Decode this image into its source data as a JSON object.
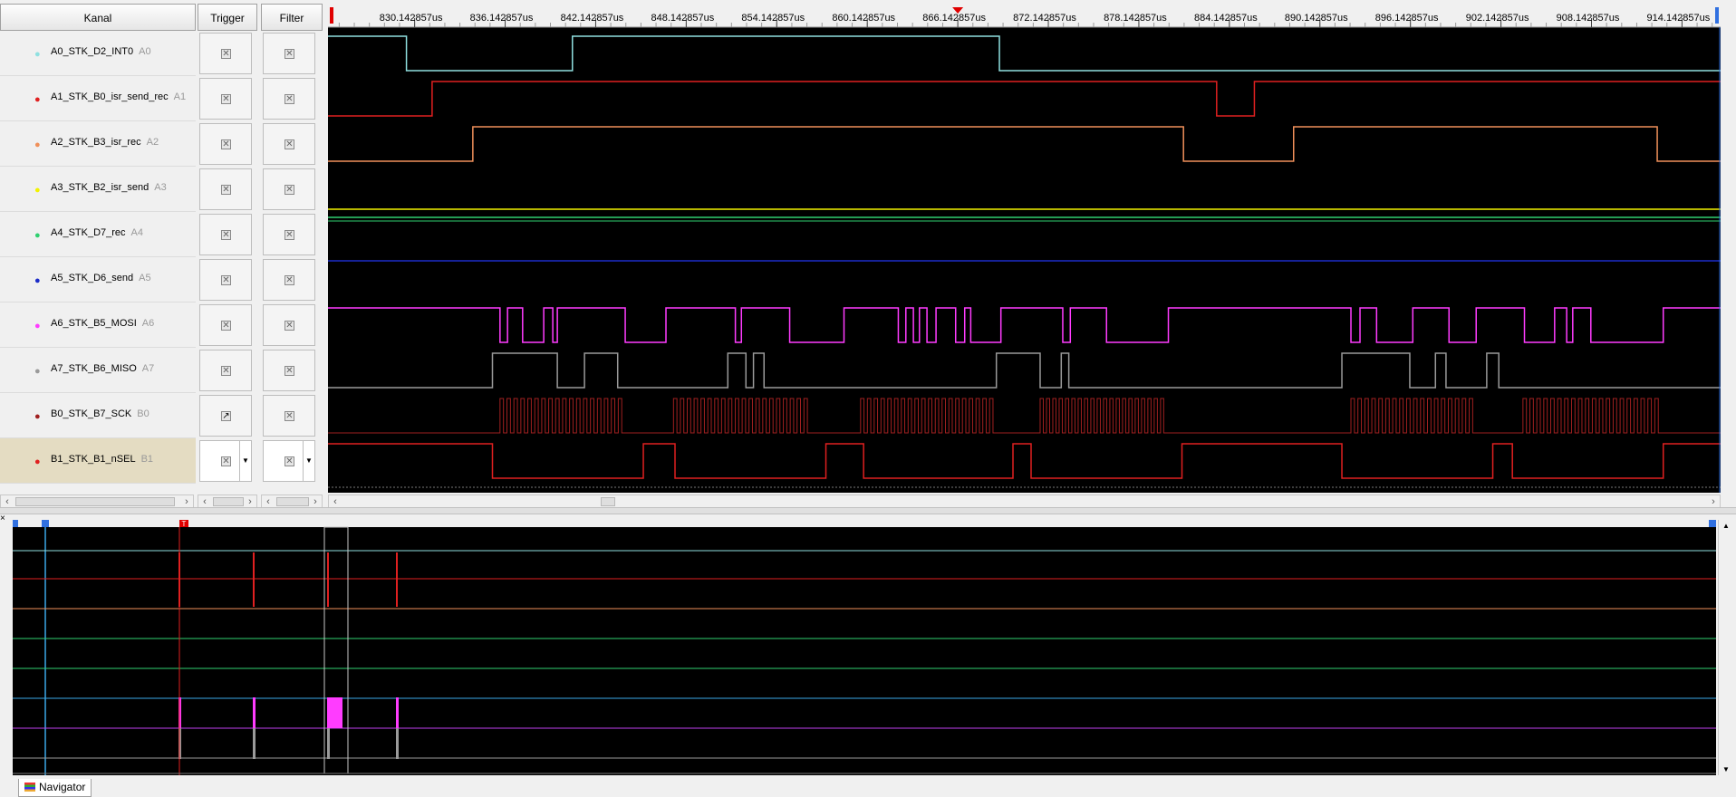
{
  "headers": {
    "channel": "Kanal",
    "trigger": "Trigger",
    "filter": "Filter"
  },
  "channels": [
    {
      "label": "A0_STK_D2_INT0",
      "pin": "A0",
      "color": "#8fe0e0"
    },
    {
      "label": "A1_STK_B0_isr_send_rec",
      "pin": "A1",
      "color": "#e02020"
    },
    {
      "label": "A2_STK_B3_isr_rec",
      "pin": "A2",
      "color": "#f0905a"
    },
    {
      "label": "A3_STK_B2_isr_send",
      "pin": "A3",
      "color": "#f2f200"
    },
    {
      "label": "A4_STK_D7_rec",
      "pin": "A4",
      "color": "#30d070"
    },
    {
      "label": "A5_STK_D6_send",
      "pin": "A5",
      "color": "#1c2cc8"
    },
    {
      "label": "A6_STK_B5_MOSI",
      "pin": "A6",
      "color": "#ff3cff"
    },
    {
      "label": "A7_STK_B6_MISO",
      "pin": "A7",
      "color": "#9a9a9a"
    },
    {
      "label": "B0_STK_B7_SCK",
      "pin": "B0",
      "color": "#a02020"
    },
    {
      "label": "B1_STK_B1_nSEL",
      "pin": "B1",
      "color": "#e02020"
    }
  ],
  "trigger_cells": [
    {
      "icon": "unchecked-box-icon"
    },
    {
      "icon": "unchecked-box-icon"
    },
    {
      "icon": "unchecked-box-icon"
    },
    {
      "icon": "unchecked-box-icon"
    },
    {
      "icon": "unchecked-box-icon"
    },
    {
      "icon": "unchecked-box-icon"
    },
    {
      "icon": "unchecked-box-icon"
    },
    {
      "icon": "unchecked-box-icon"
    },
    {
      "icon": "rising-edge-icon"
    },
    {
      "icon": "unchecked-box-icon"
    }
  ],
  "time_axis": {
    "ticks": [
      "830.142857us",
      "836.142857us",
      "842.142857us",
      "848.142857us",
      "854.142857us",
      "860.142857us",
      "866.142857us",
      "872.142857us",
      "878.142857us",
      "884.142857us",
      "890.142857us",
      "896.142857us",
      "902.142857us",
      "908.142857us",
      "914.142857us"
    ],
    "tick_times_us": [
      830.142857,
      836.142857,
      842.142857,
      848.142857,
      854.142857,
      860.142857,
      866.142857,
      872.142857,
      878.142857,
      884.142857,
      890.142857,
      896.142857,
      902.142857,
      908.142857,
      914.142857
    ],
    "start_us": 824.4,
    "end_us": 916.7,
    "cursor_time_us": 866.142857
  },
  "signals": [
    {
      "init": 1,
      "t": [
        829.6,
        840.6,
        868.9
      ]
    },
    {
      "init": 0,
      "t": [
        831.3,
        883.3,
        885.8
      ]
    },
    {
      "init": 0,
      "t": [
        834.0,
        881.1,
        888.4,
        912.5
      ]
    },
    {
      "init": 0,
      "t": [],
      "flat": "line"
    },
    {
      "init": 1,
      "t": [],
      "flat": "double"
    },
    {
      "init": 1,
      "t": [],
      "flat": "thin"
    },
    {
      "init": 1,
      "t": [
        835.8,
        836.3,
        837.3,
        838.7,
        839.3,
        839.6,
        844.1,
        846.8,
        851.4,
        851.8,
        855.0,
        858.6,
        862.2,
        862.7,
        863.2,
        863.6,
        864.1,
        864.7,
        866.0,
        866.6,
        867.0,
        869.0,
        873.1,
        873.6,
        876.0,
        880.1,
        892.2,
        892.8,
        893.9,
        896.3,
        898.7,
        900.5,
        903.7,
        905.7,
        906.5,
        906.9,
        908.1,
        912.9
      ],
      "bursts": []
    },
    {
      "init": 0,
      "t": [
        835.3,
        839.6,
        841.4,
        843.6,
        850.9,
        852.1,
        852.6,
        853.3,
        868.7,
        871.6,
        873.0,
        873.5,
        891.6,
        896.1,
        897.8,
        898.5,
        901.2,
        902.0
      ],
      "bursts": []
    },
    {
      "init": 0,
      "t": [],
      "bursts": [
        [
          835.8,
          844.1,
          18
        ],
        [
          847.3,
          856.4,
          20
        ],
        [
          859.7,
          868.7,
          20
        ],
        [
          871.6,
          880.0,
          20
        ],
        [
          892.2,
          900.5,
          18
        ],
        [
          903.6,
          912.8,
          20
        ]
      ]
    },
    {
      "init": 1,
      "t": [
        835.3,
        845.3,
        847.4,
        857.4,
        859.9,
        869.8,
        871.0,
        881.0,
        891.6,
        901.6,
        902.9,
        912.9
      ]
    }
  ],
  "navigator": {
    "label": "Navigator",
    "trigger_marker": "T"
  }
}
